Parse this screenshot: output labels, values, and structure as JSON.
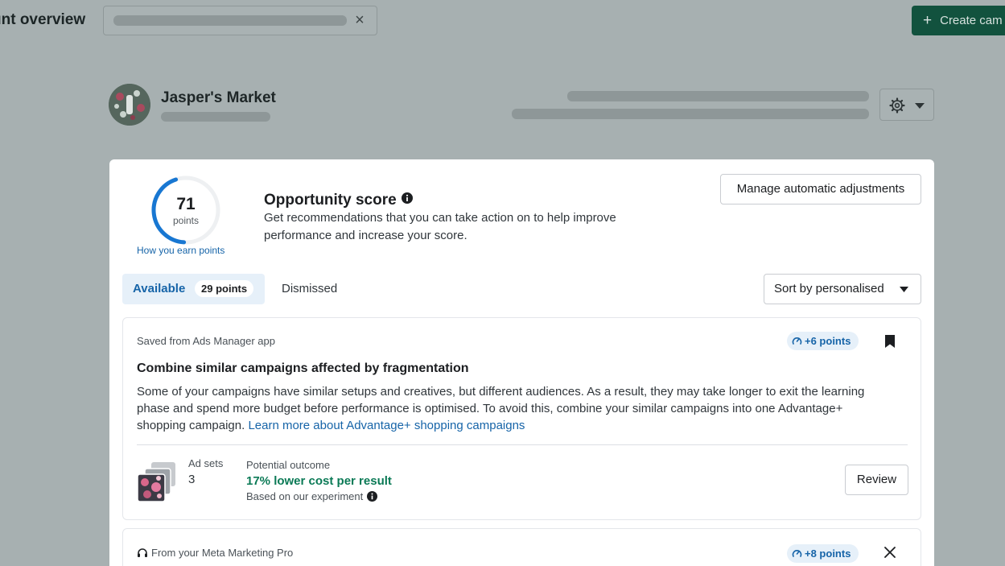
{
  "header": {
    "page_title": "unt overview",
    "create_button_label": "Create cam"
  },
  "account": {
    "name": "Jasper's Market"
  },
  "opportunity": {
    "score": "71",
    "score_unit": "points",
    "earn_link": "How you earn points",
    "title": "Opportunity score",
    "description": "Get recommendations that you can take action on to help improve performance and increase your score.",
    "manage_button": "Manage automatic adjustments",
    "score_fraction": 0.71
  },
  "tabs": {
    "available_label": "Available",
    "available_points": "29 points",
    "dismissed_label": "Dismissed"
  },
  "sort": {
    "label": "Sort by personalised"
  },
  "recommendations": [
    {
      "source": "Saved from Ads Manager app",
      "points": "+6 points",
      "title": "Combine similar campaigns affected by fragmentation",
      "body": "Some of your campaigns have similar setups and creatives, but different audiences. As a result, they may take longer to exit the learning phase and spend more budget before performance is optimised. To avoid this, combine your similar campaigns into one Advantage+ shopping campaign.",
      "link": "Learn more about Advantage+ shopping campaigns",
      "adsets_label": "Ad sets",
      "adsets_value": "3",
      "outcome_label": "Potential outcome",
      "outcome_value": "17% lower cost per result",
      "outcome_note": "Based on our experiment",
      "action_label": "Review"
    },
    {
      "source": "From your Meta Marketing Pro",
      "points": "+8 points"
    }
  ],
  "colors": {
    "backdrop": "#a7b0b1",
    "primary_green": "#12523e",
    "link_blue": "#1664a8",
    "outcome_green": "#0b7a56",
    "gauge_blue": "#1877d2"
  }
}
